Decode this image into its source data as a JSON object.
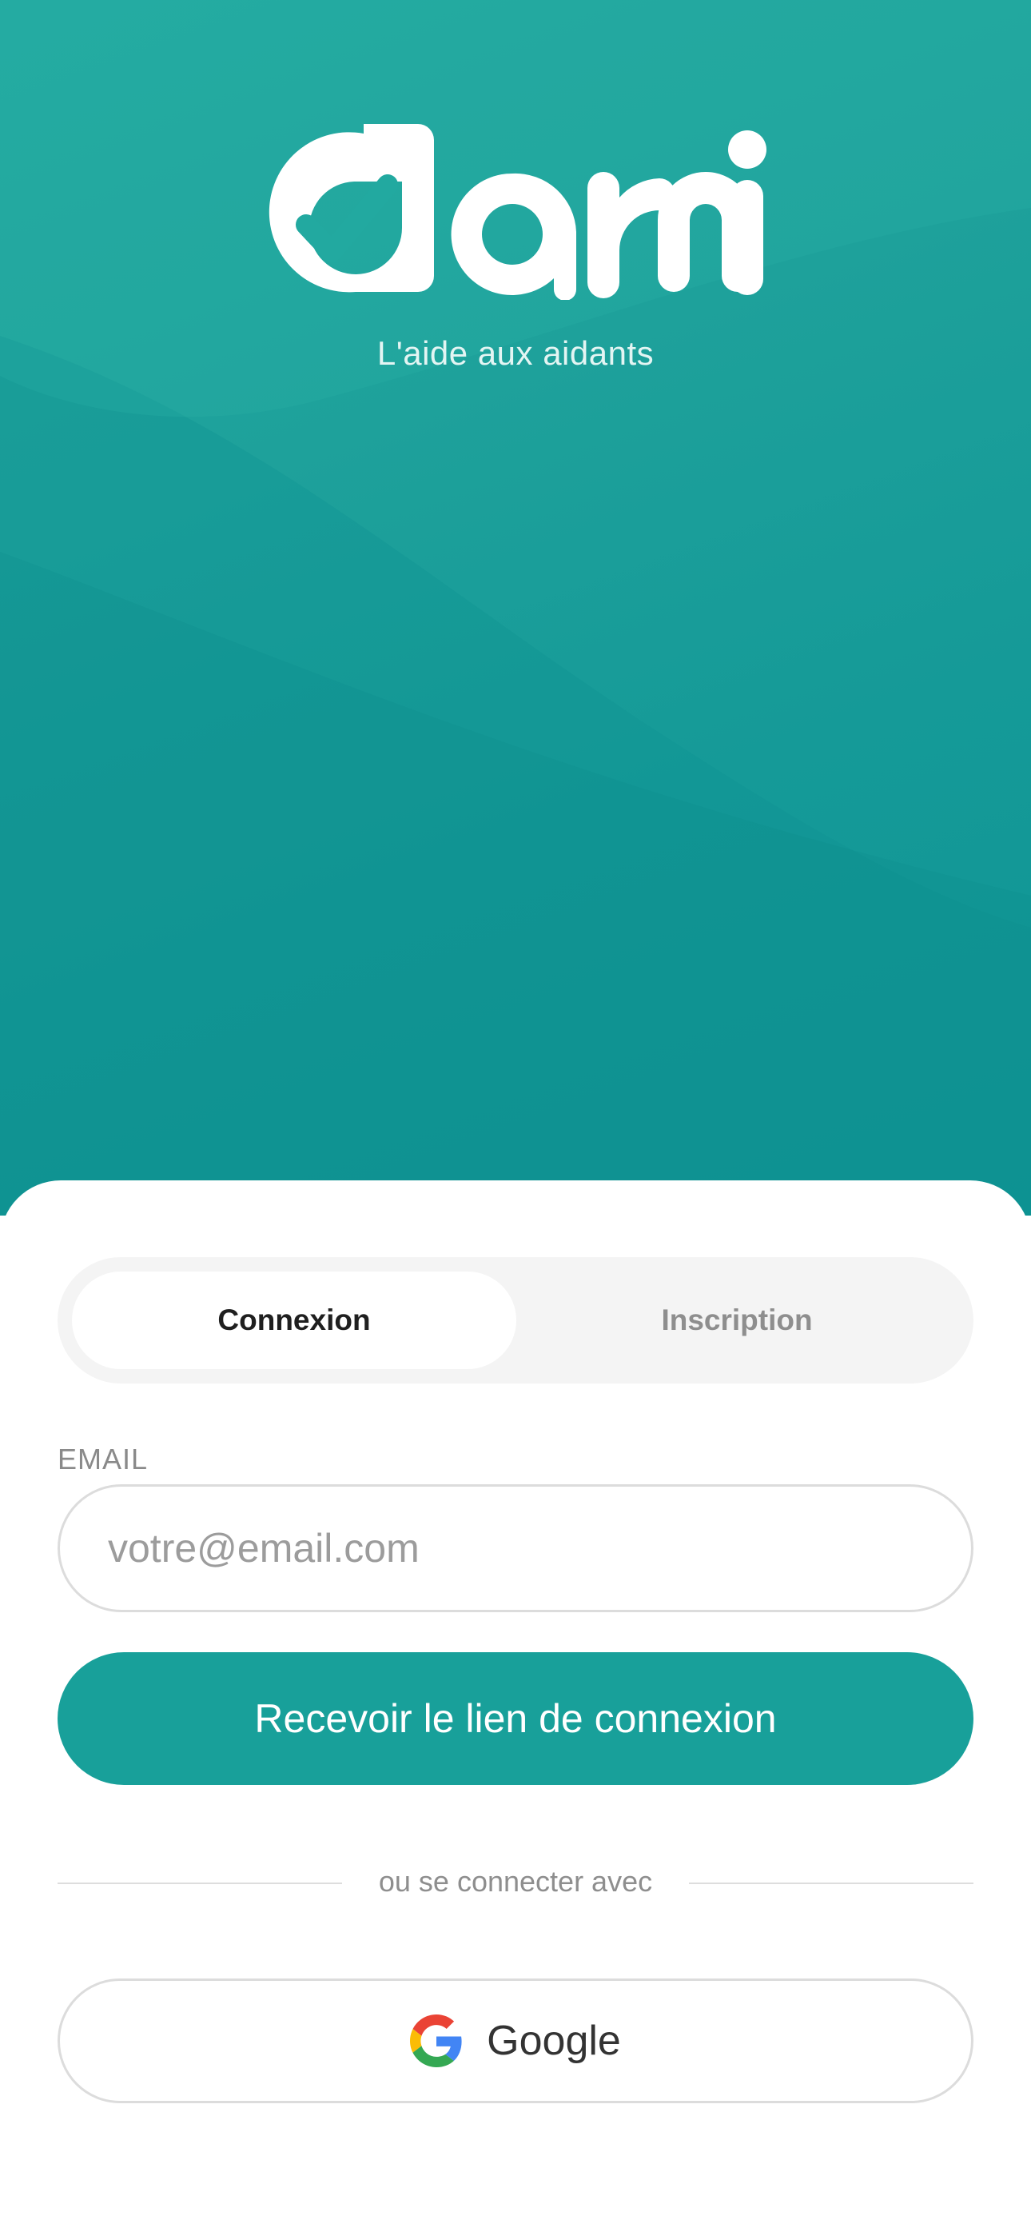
{
  "brand": {
    "logo_text": "darni",
    "tagline": "L'aide aux aidants"
  },
  "auth_tabs": {
    "login_label": "Connexion",
    "signup_label": "Inscription",
    "active": "Connexion"
  },
  "email_field": {
    "label": "EMAIL",
    "placeholder": "votre@email.com",
    "value": ""
  },
  "submit_button": {
    "label": "Recevoir le lien de connexion"
  },
  "divider": {
    "text": "ou se connecter avec"
  },
  "google_button": {
    "label": "Google",
    "icon": "google-icon"
  },
  "colors": {
    "primary": "#18a09a",
    "hero_top": "#22a9a0",
    "hero_bottom": "#0f9595",
    "text_dark": "#1f1f1f",
    "text_muted": "#8e8e8e"
  }
}
